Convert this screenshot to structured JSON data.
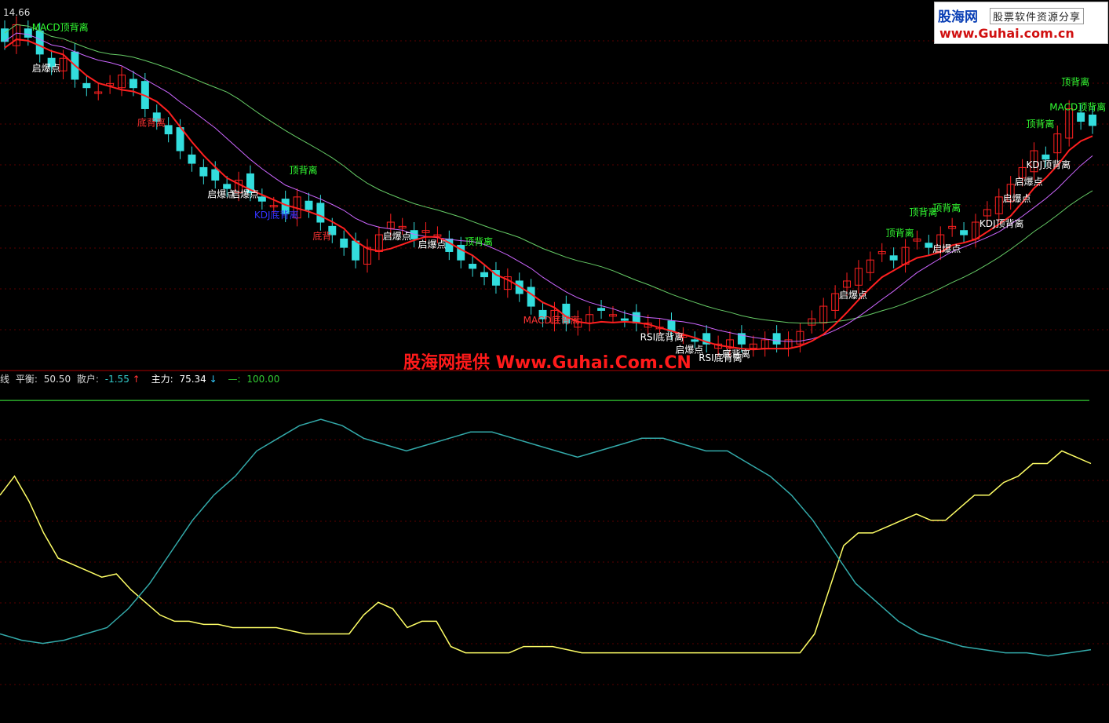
{
  "top_bar": {
    "price_label": "14.66"
  },
  "logo": {
    "brand": "股海网",
    "tagline": "股票软件资源分享",
    "url": "www.Guhai.com.cn"
  },
  "watermark": "股海网提供 Www.Guhai.Com.CN",
  "indicator_header": {
    "line_label": "线",
    "balance_label": "平衡:",
    "balance_value": "50.50",
    "retail_label": "散户:",
    "retail_value": "-1.55",
    "retail_arrow": "↑",
    "main_label": "主力:",
    "main_value": "75.34",
    "main_arrow": "↓",
    "ref_label": "—:",
    "ref_value": "100.00"
  },
  "annotations": [
    {
      "text": "MACD顶背离",
      "color": "#33ff33"
    },
    {
      "text": "底背离",
      "color": "#ff3333"
    },
    {
      "text": "启爆点",
      "color": "#ffffff"
    },
    {
      "text": "启爆点",
      "color": "#ffffff"
    },
    {
      "text": "启爆点",
      "color": "#ffffff"
    },
    {
      "text": "顶背离",
      "color": "#33ff33"
    },
    {
      "text": "底背",
      "color": "#ff3333"
    },
    {
      "text": "KDJ底背离",
      "color": "#3333ff"
    },
    {
      "text": "启爆点",
      "color": "#ffffff"
    },
    {
      "text": "顶背离",
      "color": "#33ff33"
    },
    {
      "text": "启爆点",
      "color": "#ffffff"
    },
    {
      "text": "MACD底背离",
      "color": "#ff3333"
    },
    {
      "text": "RSI底背离",
      "color": "#ffffff"
    },
    {
      "text": "底背离",
      "color": "#ffffff"
    },
    {
      "text": "RSI底背离",
      "color": "#ffffff"
    },
    {
      "text": "启爆点",
      "color": "#ffffff"
    },
    {
      "text": "启爆点",
      "color": "#ffffff"
    },
    {
      "text": "顶背离",
      "color": "#33ff33"
    },
    {
      "text": "顶背离",
      "color": "#33ff33"
    },
    {
      "text": "启爆点",
      "color": "#ffffff"
    },
    {
      "text": "顶背离",
      "color": "#33ff33"
    },
    {
      "text": "KDJ顶背离",
      "color": "#ffffff"
    },
    {
      "text": "启爆点",
      "color": "#ffffff"
    },
    {
      "text": "顶背离",
      "color": "#33ff33"
    },
    {
      "text": "KDJ顶背离",
      "color": "#ffffff"
    },
    {
      "text": "MACD顶背离",
      "color": "#33ff33"
    },
    {
      "text": "启爆点",
      "color": "#ffffff"
    },
    {
      "text": "顶背离",
      "color": "#33ff33"
    }
  ],
  "chart_data": [
    {
      "type": "candlestick",
      "title": "",
      "price_label": "14.66",
      "colors": {
        "up": "#ff2020",
        "down": "#33dddd",
        "ma_fast": "#ff2020",
        "ma_mid": "#cc66ff",
        "ma_slow": "#66cc66"
      },
      "close_path": [
        14.2,
        14.6,
        14.3,
        13.9,
        13.6,
        13.8,
        13.3,
        13.1,
        13.0,
        13.2,
        13.4,
        13.1,
        12.6,
        12.3,
        12.0,
        11.6,
        11.3,
        11.0,
        10.9,
        10.7,
        10.9,
        10.6,
        10.4,
        10.3,
        10.1,
        10.5,
        10.2,
        9.9,
        9.6,
        9.3,
        9.0,
        9.3,
        9.6,
        9.9,
        9.8,
        9.5,
        9.7,
        9.6,
        9.2,
        9.0,
        8.8,
        8.6,
        8.4,
        8.6,
        8.2,
        7.9,
        7.6,
        7.8,
        7.5,
        7.6,
        7.7,
        7.8,
        7.7,
        7.6,
        7.5,
        7.5,
        7.4,
        7.3,
        7.2,
        7.1,
        7.0,
        7.0,
        7.1,
        7.0,
        7.0,
        7.1,
        7.0,
        7.1,
        7.3,
        7.6,
        7.9,
        8.2,
        8.5,
        8.8,
        9.0,
        9.2,
        9.0,
        9.3,
        9.5,
        9.3,
        9.6,
        9.8,
        9.6,
        9.9,
        10.2,
        10.5,
        10.8,
        11.2,
        11.6,
        11.4,
        12.0,
        12.6,
        12.3,
        12.2
      ]
    },
    {
      "type": "line",
      "title": "",
      "series": [
        {
          "name": "散户",
          "color": "#ffff66",
          "values": [
            70,
            76,
            68,
            58,
            50,
            48,
            46,
            44,
            45,
            40,
            36,
            32,
            30,
            30,
            29,
            29,
            28,
            28,
            28,
            28,
            27,
            26,
            26,
            26,
            26,
            32,
            36,
            34,
            28,
            30,
            30,
            22,
            20,
            20,
            20,
            20,
            22,
            22,
            22,
            21,
            20,
            20,
            20,
            20,
            20,
            20,
            20,
            20,
            20,
            20,
            20,
            20,
            20,
            20,
            20,
            20,
            26,
            40,
            54,
            58,
            58,
            60,
            62,
            64,
            62,
            62,
            66,
            70,
            70,
            74,
            76,
            80,
            80,
            84,
            82,
            80
          ]
        },
        {
          "name": "主力",
          "color": "#33aaaa",
          "values": [
            26,
            24,
            23,
            24,
            26,
            28,
            34,
            42,
            52,
            62,
            70,
            76,
            84,
            88,
            92,
            94,
            92,
            88,
            86,
            84,
            86,
            88,
            90,
            90,
            88,
            86,
            84,
            82,
            84,
            86,
            88,
            88,
            86,
            84,
            84,
            80,
            76,
            70,
            62,
            52,
            42,
            36,
            30,
            26,
            24,
            22,
            21,
            20,
            20,
            19,
            20,
            21
          ]
        },
        {
          "name": "—",
          "color": "#33cc33",
          "values": [
            100
          ]
        }
      ],
      "ylim": [
        0,
        105
      ]
    }
  ]
}
